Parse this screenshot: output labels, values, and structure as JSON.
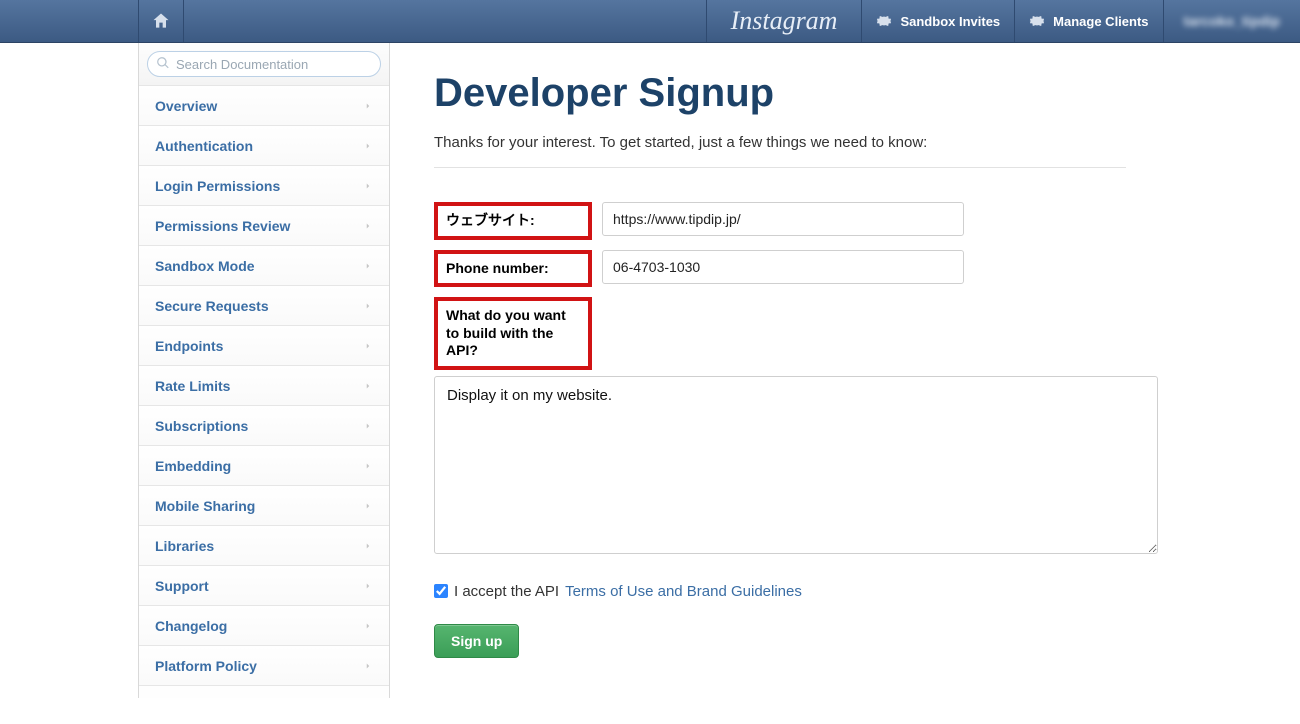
{
  "topbar": {
    "brand": "Instagram",
    "sandbox_label": "Sandbox Invites",
    "manage_label": "Manage Clients",
    "user_label": "tarcoko_tipdip"
  },
  "search": {
    "placeholder": "Search Documentation"
  },
  "sidebar": {
    "items": [
      {
        "label": "Overview"
      },
      {
        "label": "Authentication"
      },
      {
        "label": "Login Permissions"
      },
      {
        "label": "Permissions Review"
      },
      {
        "label": "Sandbox Mode"
      },
      {
        "label": "Secure Requests"
      },
      {
        "label": "Endpoints"
      },
      {
        "label": "Rate Limits"
      },
      {
        "label": "Subscriptions"
      },
      {
        "label": "Embedding"
      },
      {
        "label": "Mobile Sharing"
      },
      {
        "label": "Libraries"
      },
      {
        "label": "Support"
      },
      {
        "label": "Changelog"
      },
      {
        "label": "Platform Policy"
      }
    ]
  },
  "main": {
    "title": "Developer Signup",
    "intro": "Thanks for your interest. To get started, just a few things we need to know:",
    "website_label": "ウェブサイト:",
    "website_value": "https://www.tipdip.jp/",
    "phone_label": "Phone number:",
    "phone_value": "06-4703-1030",
    "build_label": "What do you want to build with the API?",
    "build_value": "Display it on my website.",
    "accept_prefix": "I accept the API ",
    "accept_link": "Terms of Use and Brand Guidelines",
    "accept_checked": true,
    "signup_label": "Sign up"
  }
}
